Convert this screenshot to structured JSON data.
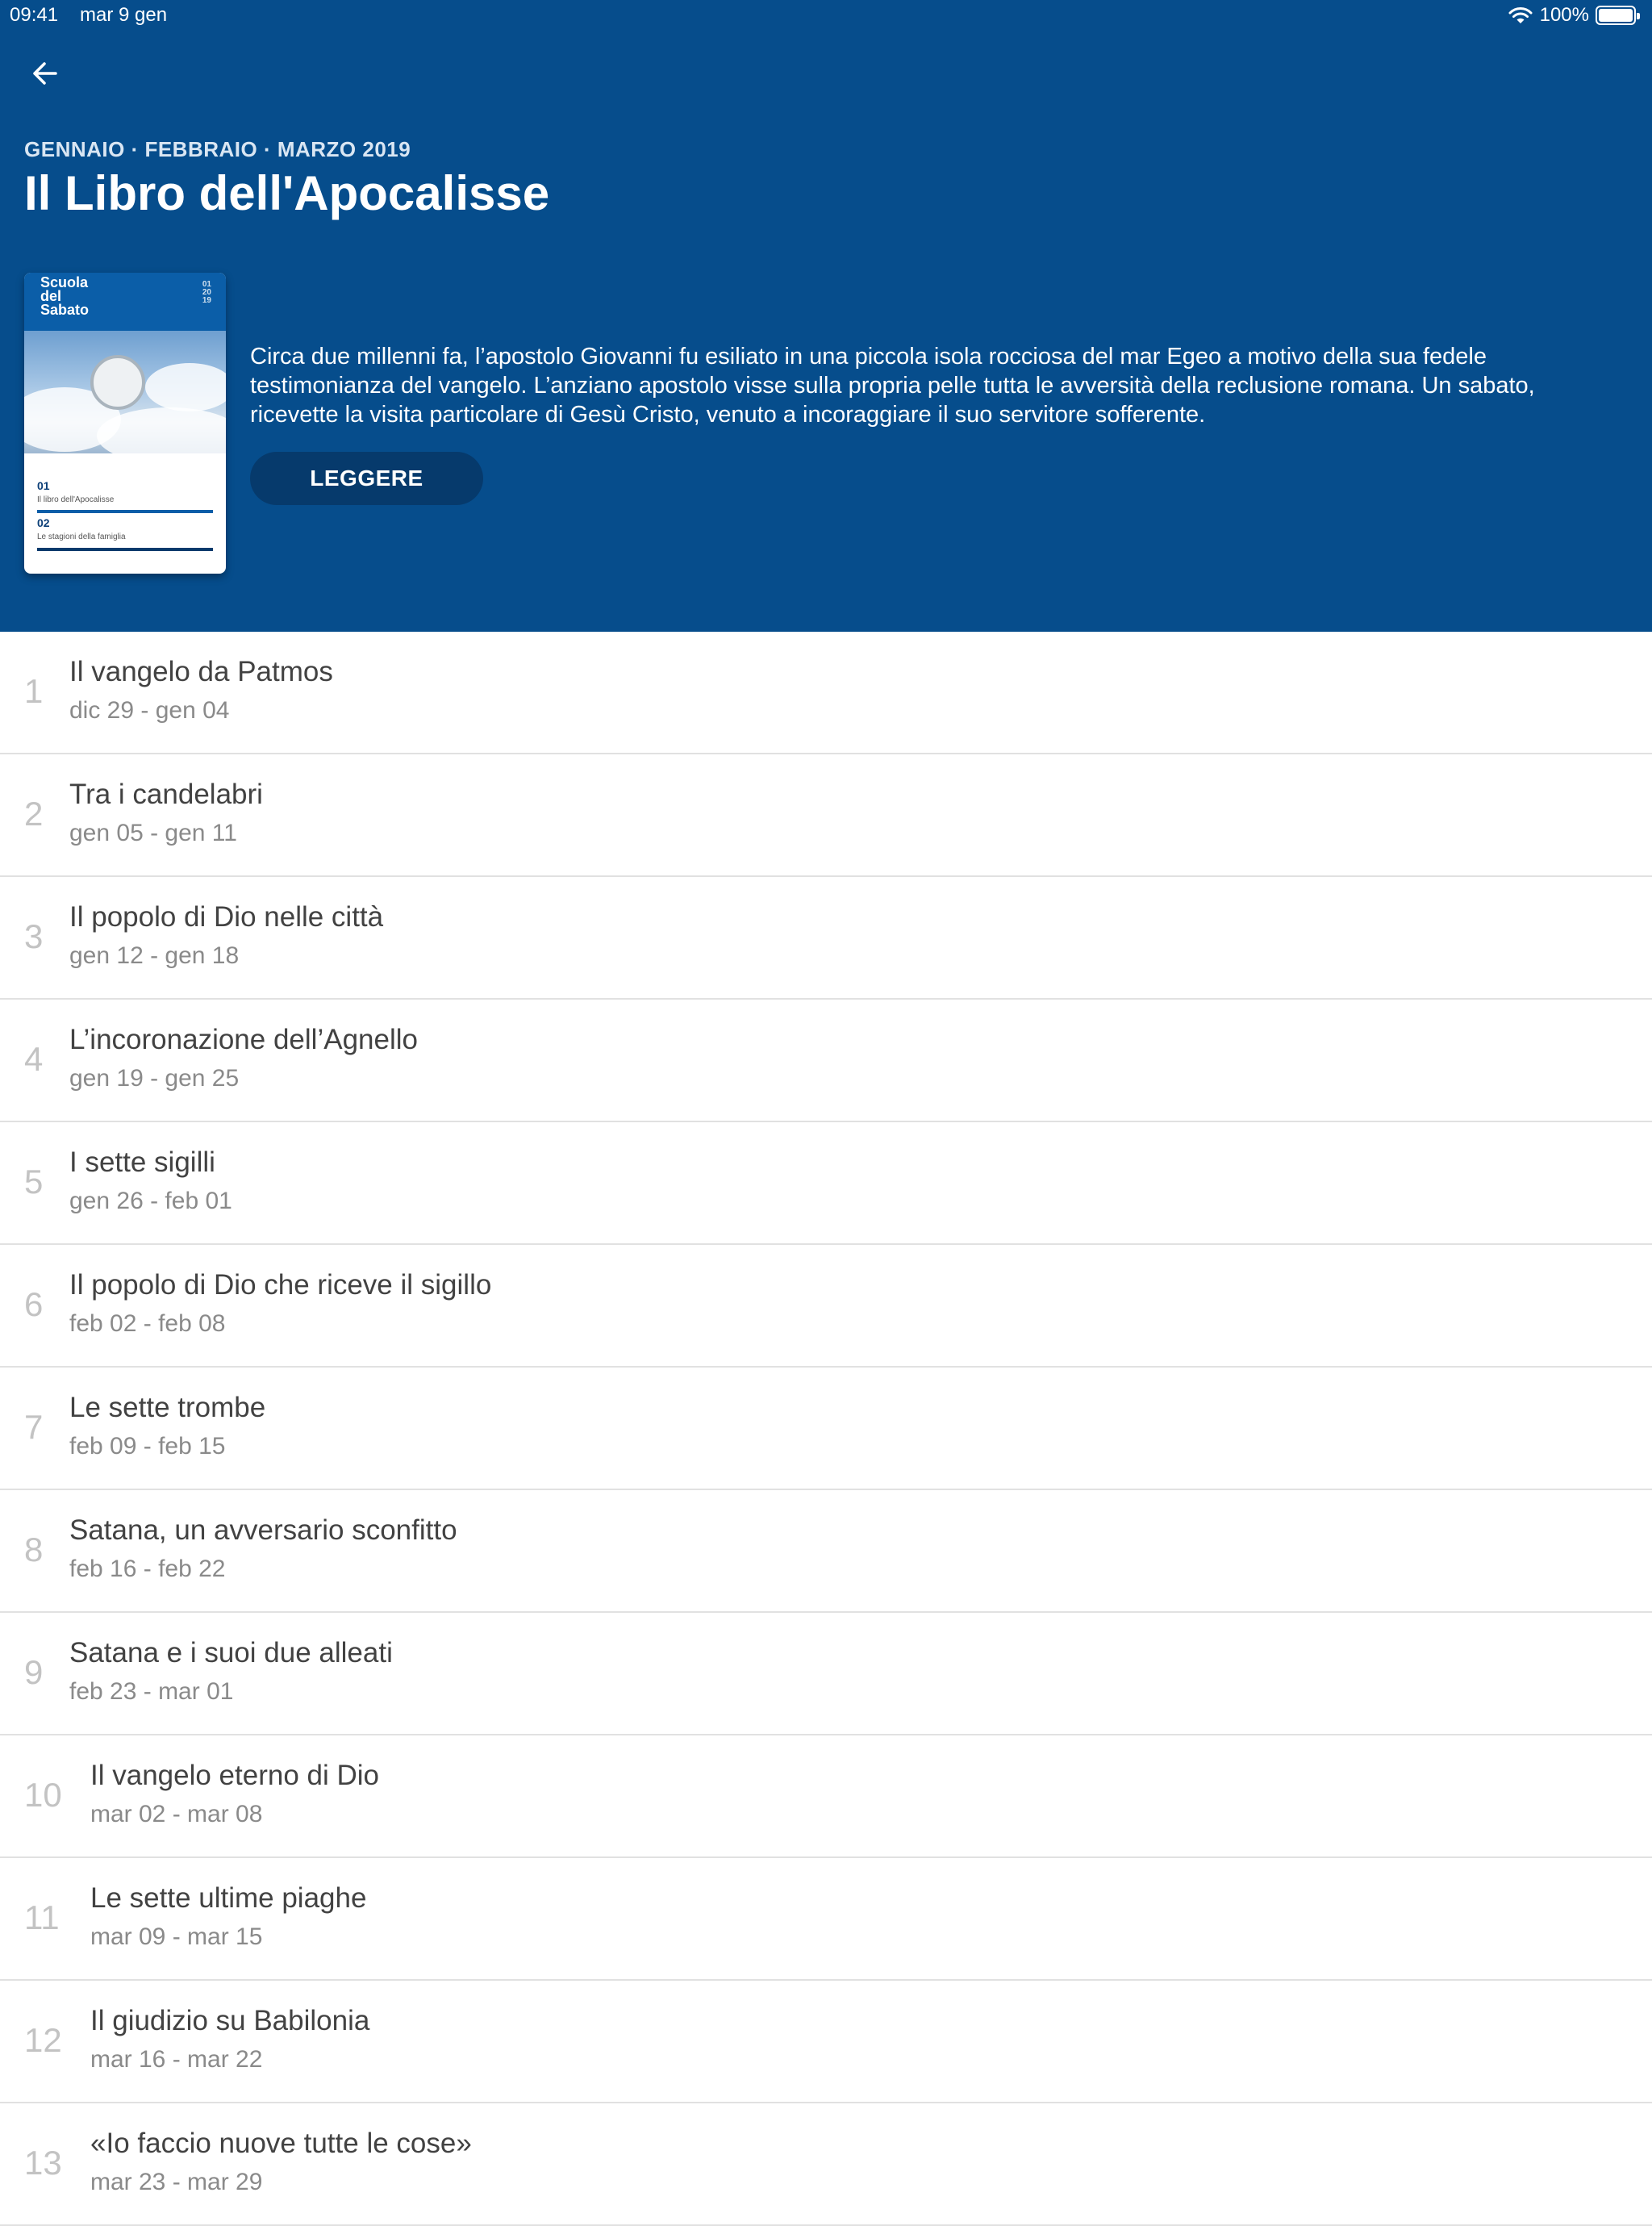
{
  "status_bar": {
    "time": "09:41",
    "date": "mar 9 gen",
    "battery": "100%"
  },
  "header": {
    "quarter": "GENNAIO · FEBBRAIO · MARZO 2019",
    "title": "Il Libro dell'Apocalisse",
    "description": "Circa due millenni fa, l’apostolo Giovanni fu esiliato in una piccola isola rocciosa del mar Egeo a motivo della sua fedele testimonianza del vangelo. L’anziano apostolo visse sulla propria pelle tutta le avversità della reclusione romana. Un sabato, ricevette la visita particolare di Gesù Cristo, venuto a incoraggiare il suo servitore sofferente.",
    "read_button": "LEGGERE"
  },
  "cover": {
    "brand": "Scuola\ndel\nSabato",
    "number": "01\n20\n19",
    "lessons": [
      {
        "num": "01",
        "label": "Il libro dell'Apocalisse"
      },
      {
        "num": "02",
        "label": "Le stagioni della famiglia"
      }
    ]
  },
  "lessons": [
    {
      "index": "1",
      "title": "Il vangelo da Patmos",
      "dates": "dic 29 - gen 04"
    },
    {
      "index": "2",
      "title": "Tra i candelabri",
      "dates": "gen 05 - gen 11"
    },
    {
      "index": "3",
      "title": "Il popolo di Dio nelle città",
      "dates": "gen 12 - gen 18"
    },
    {
      "index": "4",
      "title": "L’incoronazione dell’Agnello",
      "dates": "gen 19 - gen 25"
    },
    {
      "index": "5",
      "title": "I sette sigilli",
      "dates": "gen 26 - feb 01"
    },
    {
      "index": "6",
      "title": "Il popolo di Dio che riceve il sigillo",
      "dates": "feb 02 - feb 08"
    },
    {
      "index": "7",
      "title": "Le sette trombe",
      "dates": "feb 09 - feb 15"
    },
    {
      "index": "8",
      "title": "Satana, un avversario sconfitto",
      "dates": "feb 16 - feb 22"
    },
    {
      "index": "9",
      "title": "Satana e i suoi due alleati",
      "dates": "feb 23 - mar 01"
    },
    {
      "index": "10",
      "title": "Il vangelo eterno di Dio",
      "dates": "mar 02 - mar 08"
    },
    {
      "index": "11",
      "title": "Le sette ultime piaghe",
      "dates": "mar 09 - mar 15"
    },
    {
      "index": "12",
      "title": "Il giudizio su Babilonia",
      "dates": "mar 16 - mar 22"
    },
    {
      "index": "13",
      "title": "«Io faccio nuove tutte le cose»",
      "dates": "mar 23 - mar 29"
    }
  ]
}
